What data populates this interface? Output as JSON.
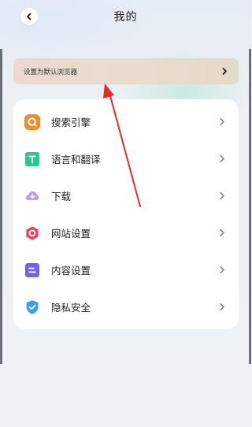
{
  "header": {
    "title": "我的"
  },
  "banner": {
    "label": "设置为默认浏览器"
  },
  "menu": {
    "items": [
      {
        "label": "搜索引擎",
        "icon": "search-engine-icon",
        "color": "#f08c2c"
      },
      {
        "label": "语言和翻译",
        "icon": "translate-icon",
        "color": "#2ac88e"
      },
      {
        "label": "下载",
        "icon": "download-icon",
        "color": "#b79cf1"
      },
      {
        "label": "网站设置",
        "icon": "website-settings-icon",
        "color": "#ec3f63"
      },
      {
        "label": "内容设置",
        "icon": "content-settings-icon",
        "color": "#7560e8"
      },
      {
        "label": "隐私安全",
        "icon": "privacy-shield-icon",
        "color": "#3a9df0"
      }
    ]
  },
  "colors": {
    "annotation_arrow": "#e52a2a"
  }
}
